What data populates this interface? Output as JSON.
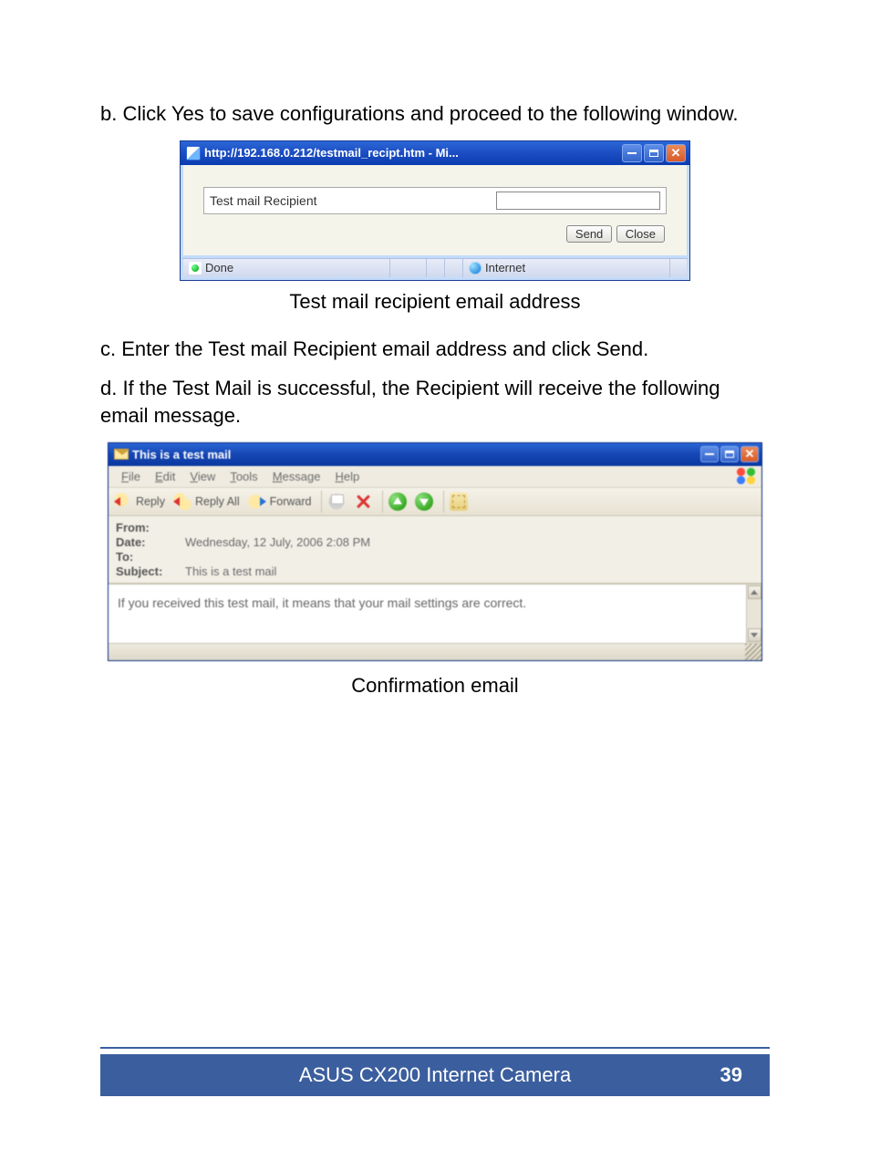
{
  "step_b_text": "b. Click Yes to save configurations and proceed to the following window.",
  "window1": {
    "title": "http://192.168.0.212/testmail_recipt.htm - Mi...",
    "field_label": "Test mail Recipient",
    "input_value": "",
    "btn_send": "Send",
    "btn_close": "Close",
    "status_done": "Done",
    "status_zone": "Internet"
  },
  "caption1": "Test mail recipient email address",
  "step_c_text": "c. Enter the Test mail Recipient email address and click Send.",
  "step_d_text": "d. If the Test Mail is successful, the Recipient will receive the following email message.",
  "window2": {
    "title": "This is a test mail",
    "menu": {
      "file": "File",
      "edit": "Edit",
      "view": "View",
      "tools": "Tools",
      "message": "Message",
      "help": "Help"
    },
    "toolbar": {
      "reply": "Reply",
      "replyall": "Reply All",
      "forward": "Forward"
    },
    "headers": {
      "from_k": "From:",
      "from_v": "",
      "date_k": "Date:",
      "date_v": "Wednesday, 12 July, 2006 2:08 PM",
      "to_k": "To:",
      "to_v": "",
      "subject_k": "Subject:",
      "subject_v": "This is a test mail"
    },
    "body": "If you received this test mail, it means that your mail settings are correct."
  },
  "caption2": "Confirmation email",
  "footer": {
    "title": "ASUS CX200 Internet Camera",
    "page": "39"
  }
}
